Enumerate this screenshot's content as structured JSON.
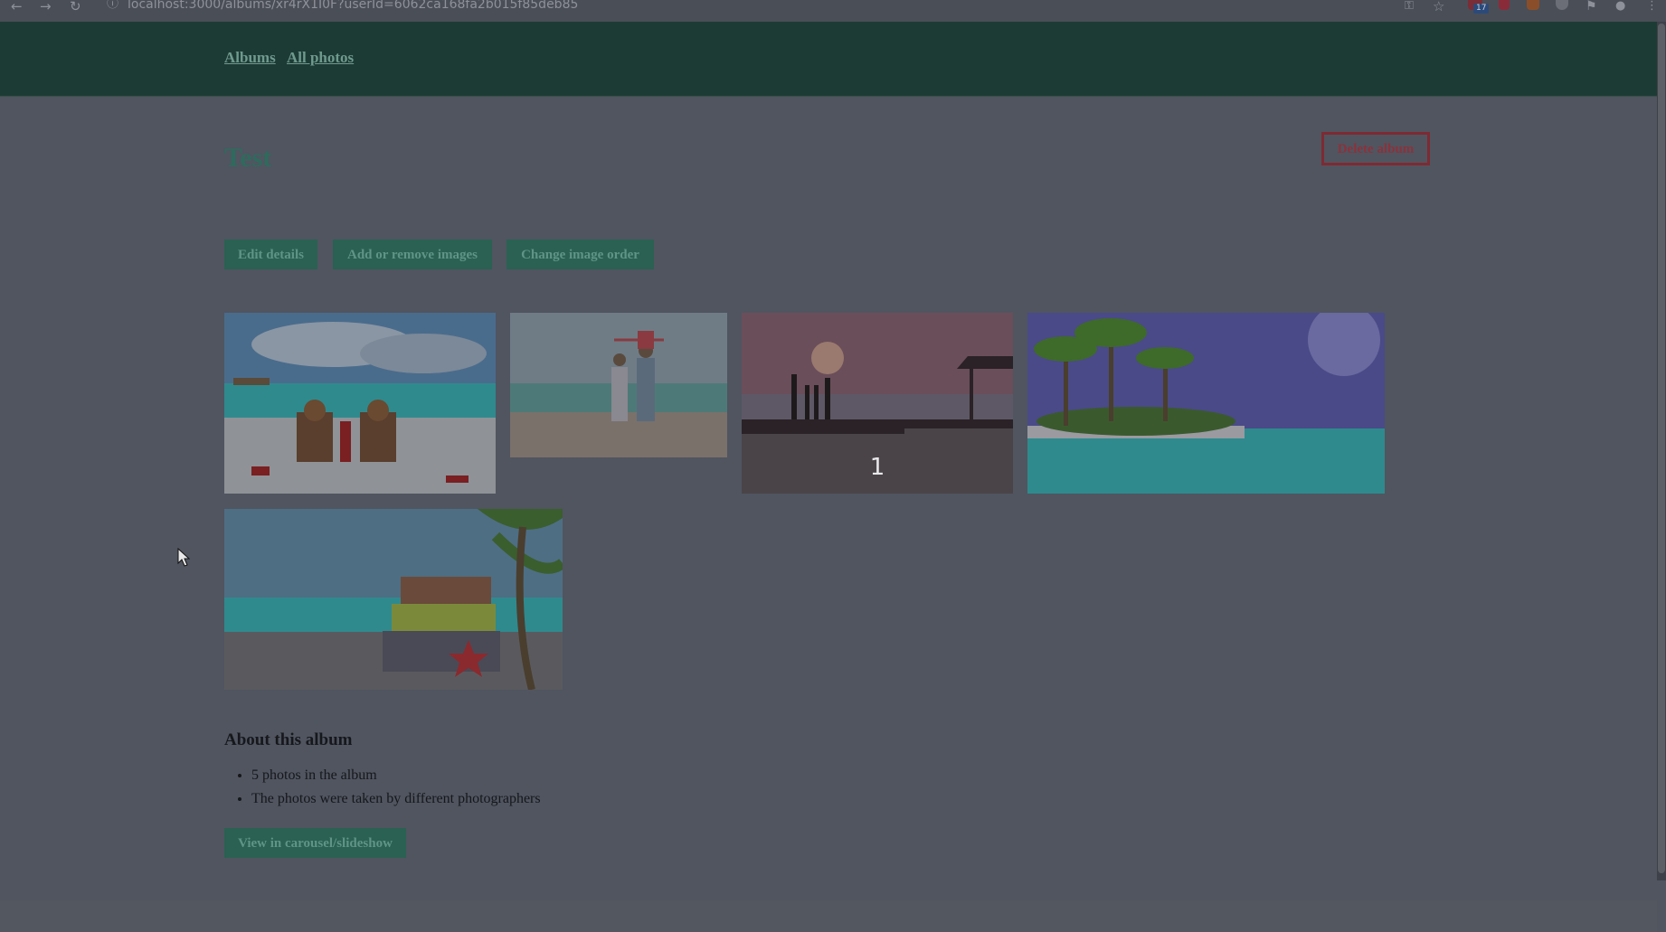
{
  "browser": {
    "url": "localhost:3000/albums/xr4rX1I0F?userId=6062ca168fa2b015f85deb85",
    "badge_count": "17",
    "extension_colors": [
      "#7a2d36",
      "#8a2b3a",
      "#8a4f2a",
      "#6b6e76",
      "#6b6e76",
      "#6b6e76"
    ]
  },
  "nav": {
    "albums_label": "Albums",
    "all_photos_label": "All photos"
  },
  "album": {
    "title": "Test",
    "delete_label": "Delete album"
  },
  "actions": {
    "edit_label": "Edit details",
    "add_remove_label": "Add or remove images",
    "order_label": "Change image order"
  },
  "photos": [
    {
      "icon": "beach-chairs-photo",
      "caption": ""
    },
    {
      "icon": "family-on-beach-photo",
      "caption": ""
    },
    {
      "icon": "pier-sunset-photo",
      "caption": "1"
    },
    {
      "icon": "tropical-island-photo",
      "caption": ""
    },
    {
      "icon": "suitcases-palm-photo",
      "caption": ""
    }
  ],
  "about": {
    "heading": "About this album",
    "facts": [
      "5 photos in the album",
      "The photos were taken by different photographers"
    ],
    "carousel_label": "View in carousel/slideshow"
  },
  "colors": {
    "header_bg": "#1d3b35",
    "accent_green": "#2a6152",
    "danger": "#7e2a33",
    "page_bg": "#505560"
  }
}
